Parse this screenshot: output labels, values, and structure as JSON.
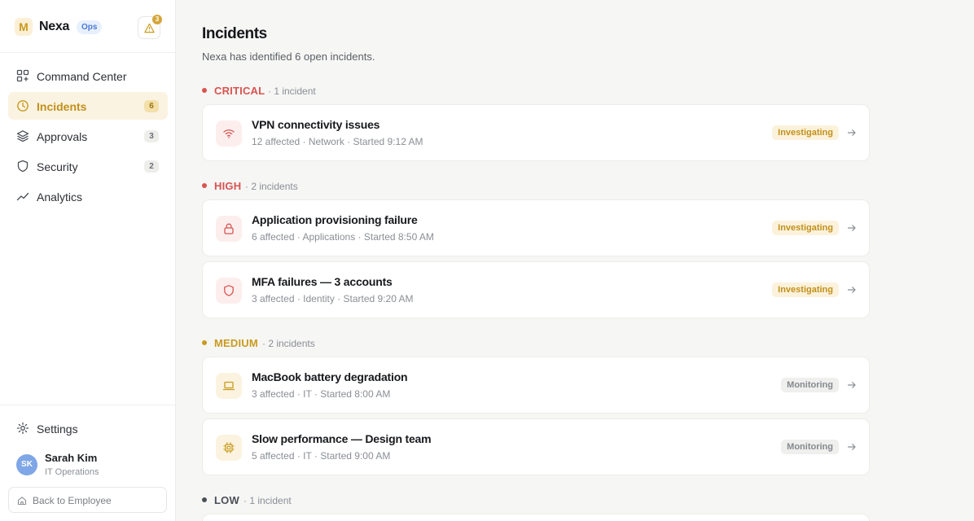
{
  "brand": {
    "logo": "M",
    "name": "Nexa",
    "tag": "Ops",
    "alert_count": "3"
  },
  "nav": [
    {
      "label": "Command Center",
      "icon": "grid-icon",
      "badge": ""
    },
    {
      "label": "Incidents",
      "icon": "clock-icon",
      "badge": "6"
    },
    {
      "label": "Approvals",
      "icon": "layers-icon",
      "badge": "3"
    },
    {
      "label": "Security",
      "icon": "shield-icon",
      "badge": "2"
    },
    {
      "label": "Analytics",
      "icon": "trend-icon",
      "badge": ""
    }
  ],
  "footer": {
    "settings": "Settings",
    "user": {
      "initials": "SK",
      "name": "Sarah Kim",
      "role": "IT Operations"
    },
    "back": "Back to Employee"
  },
  "page": {
    "title": "Incidents",
    "subtitle": "Nexa has identified 6 open incidents."
  },
  "colors": {
    "accent": "#c99a1e",
    "critical": "#d9534f",
    "medium": "#c99a1e",
    "low": "#4a4f57"
  },
  "groups": [
    {
      "name": "CRITICAL",
      "count": "· 1 incident",
      "color": "#d9534f"
    },
    {
      "name": "HIGH",
      "count": "· 2 incidents",
      "color": "#d9534f"
    },
    {
      "name": "MEDIUM",
      "count": "· 2 incidents",
      "color": "#c99a1e"
    },
    {
      "name": "LOW",
      "count": "· 1 incident",
      "color": "#4a4f57"
    }
  ],
  "incidents": [
    {
      "title": "VPN connectivity issues",
      "meta": "12 affected · Network · Started 9:12 AM",
      "status": "Investigating",
      "icon": "wifi-icon"
    },
    {
      "title": "Application provisioning failure",
      "meta": "6 affected · Applications · Started 8:50 AM",
      "status": "Investigating",
      "icon": "lock-icon"
    },
    {
      "title": "MFA failures — 3 accounts",
      "meta": "3 affected · Identity · Started 9:20 AM",
      "status": "Investigating",
      "icon": "shield-icon"
    },
    {
      "title": "MacBook battery degradation",
      "meta": "3 affected · IT · Started 8:00 AM",
      "status": "Monitoring",
      "icon": "laptop-icon"
    },
    {
      "title": "Slow performance — Design team",
      "meta": "5 affected · IT · Started 9:00 AM",
      "status": "Monitoring",
      "icon": "chip-icon"
    }
  ]
}
